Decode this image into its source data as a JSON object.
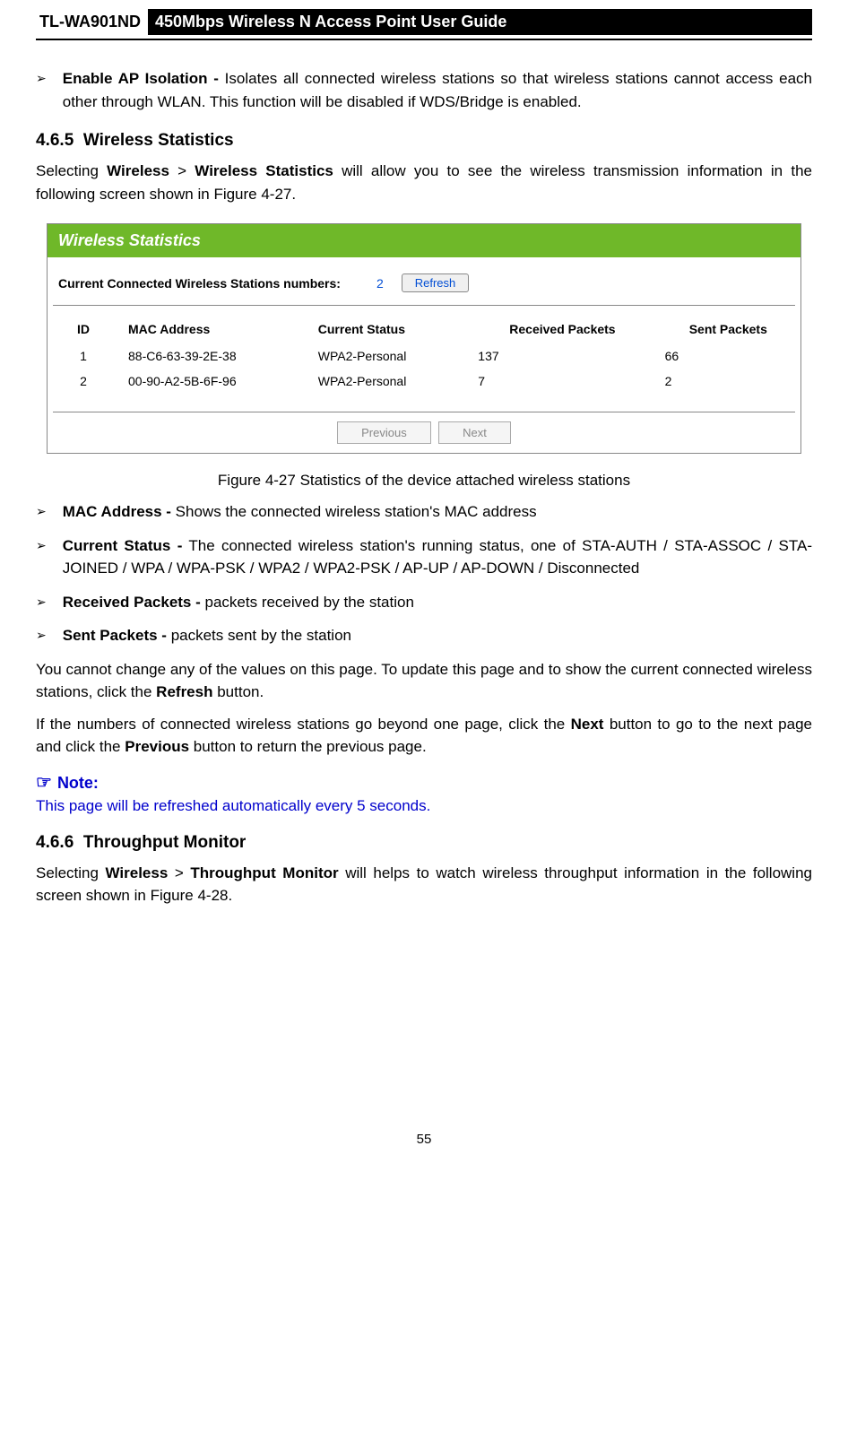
{
  "header": {
    "model": "TL-WA901ND",
    "title": "450Mbps Wireless N Access Point User Guide"
  },
  "bullets_top": [
    {
      "label": "Enable AP Isolation -",
      "text": " Isolates all connected wireless stations so that wireless stations cannot access each other through WLAN. This function will be disabled if WDS/Bridge is enabled."
    }
  ],
  "section_465": {
    "number": "4.6.5",
    "title": "Wireless Statistics",
    "intro_pre": "Selecting ",
    "intro_b1": "Wireless",
    "intro_mid": " > ",
    "intro_b2": "Wireless Statistics",
    "intro_post": " will allow you to see the wireless transmission information in the following screen shown in Figure 4-27."
  },
  "figure": {
    "header": "Wireless Statistics",
    "label": "Current Connected Wireless Stations numbers:",
    "count": "2",
    "refresh": "Refresh",
    "columns": [
      "ID",
      "MAC Address",
      "Current Status",
      "Received Packets",
      "Sent Packets"
    ],
    "rows": [
      {
        "id": "1",
        "mac": "88-C6-63-39-2E-38",
        "status": "WPA2-Personal",
        "recv": "137",
        "sent": "66"
      },
      {
        "id": "2",
        "mac": "00-90-A2-5B-6F-96",
        "status": "WPA2-Personal",
        "recv": "7",
        "sent": "2"
      }
    ],
    "prev": "Previous",
    "next": "Next",
    "caption": "Figure 4-27 Statistics of the device attached wireless stations"
  },
  "bullets_mid": [
    {
      "label": "MAC Address -",
      "text": " Shows the connected wireless station's MAC address"
    },
    {
      "label": "Current Status -",
      "text": " The connected wireless station's running status, one of STA-AUTH / STA-ASSOC / STA-JOINED / WPA / WPA-PSK / WPA2 / WPA2-PSK / AP-UP / AP-DOWN / Disconnected"
    },
    {
      "label": "Received Packets -",
      "text": " packets received by the station"
    },
    {
      "label": "Sent Packets -",
      "text": " packets sent by the station"
    }
  ],
  "para1_pre": "You cannot change any of the values on this page. To update this page and to show the current connected wireless stations, click the ",
  "para1_b": "Refresh",
  "para1_post": " button.",
  "para2_pre": "If the numbers of connected wireless stations go beyond one page, click the ",
  "para2_b1": "Next",
  "para2_mid": " button to go to the next page and click the ",
  "para2_b2": "Previous",
  "para2_post": " button to return the previous page.",
  "note": {
    "label": "Note:",
    "text": "This page will be refreshed automatically every 5 seconds."
  },
  "section_466": {
    "number": "4.6.6",
    "title": "Throughput Monitor",
    "intro_pre": "Selecting ",
    "intro_b1": "Wireless",
    "intro_mid": " > ",
    "intro_b2": "Throughput Monitor",
    "intro_post": " will helps to watch wireless throughput information in the following screen shown in Figure 4-28."
  },
  "page_number": "55"
}
